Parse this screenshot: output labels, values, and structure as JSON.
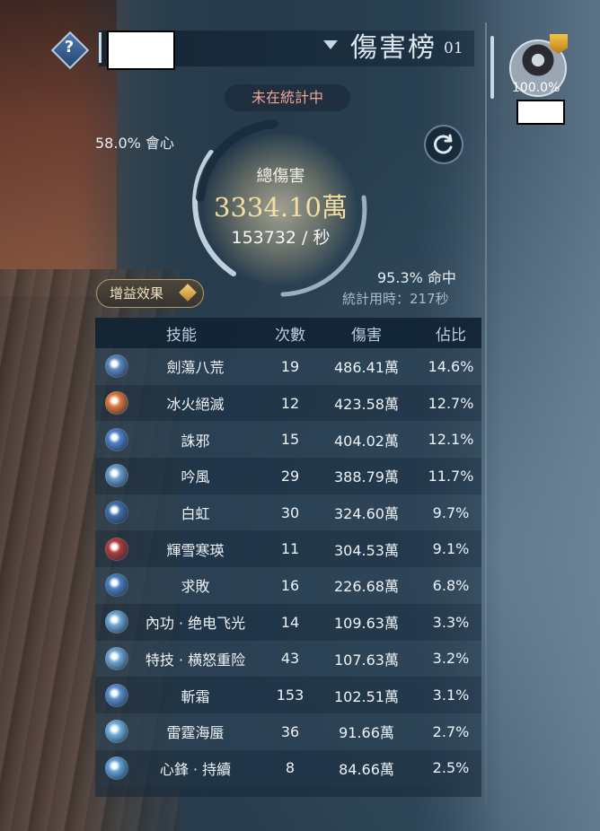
{
  "header": {
    "help_label": "?",
    "rank_title": "傷害榜",
    "rank_number": "01"
  },
  "status": "未在統計中",
  "summary": {
    "crit": "58.0% 會心",
    "total_label": "總傷害",
    "total_value": "3334.10萬",
    "dps": "153732 / 秒",
    "hit": "95.3% 命中",
    "time": "統計用時：217秒"
  },
  "buff_button": "增益效果",
  "table": {
    "headers": [
      "技能",
      "次數",
      "傷害",
      "佔比"
    ],
    "rows": [
      {
        "name": "劍蕩八荒",
        "count": "19",
        "damage": "486.41萬",
        "pct": "14.6%",
        "color": "#5b86c2"
      },
      {
        "name": "冰火絕滅",
        "count": "12",
        "damage": "423.58萬",
        "pct": "12.7%",
        "color": "#e0783a"
      },
      {
        "name": "誅邪",
        "count": "15",
        "damage": "404.02萬",
        "pct": "12.1%",
        "color": "#4f7fc4"
      },
      {
        "name": "吟風",
        "count": "29",
        "damage": "388.79萬",
        "pct": "11.7%",
        "color": "#6a9cd0"
      },
      {
        "name": "白虹",
        "count": "30",
        "damage": "324.60萬",
        "pct": "9.7%",
        "color": "#3f6fab"
      },
      {
        "name": "輝雪寒瑛",
        "count": "11",
        "damage": "304.53萬",
        "pct": "9.1%",
        "color": "#b23b3b"
      },
      {
        "name": "求敗",
        "count": "16",
        "damage": "226.68萬",
        "pct": "6.8%",
        "color": "#4a7fc0"
      },
      {
        "name": "內功 · 绝电飞光",
        "count": "14",
        "damage": "109.63萬",
        "pct": "3.3%",
        "color": "#6ea6d6"
      },
      {
        "name": "特技 · 横怒重险",
        "count": "43",
        "damage": "107.63萬",
        "pct": "3.2%",
        "color": "#6ea6d6"
      },
      {
        "name": "斬霜",
        "count": "153",
        "damage": "102.51萬",
        "pct": "3.1%",
        "color": "#5a8fcd"
      },
      {
        "name": "雷霆海蜃",
        "count": "36",
        "damage": "91.66萬",
        "pct": "2.7%",
        "color": "#6fb0dc"
      },
      {
        "name": "心鋒 · 持續",
        "count": "8",
        "damage": "84.66萬",
        "pct": "2.5%",
        "color": "#5fa0d8"
      }
    ]
  },
  "player": {
    "pct": "100.0%"
  },
  "colors": {
    "gold_value": "#f3dfa4",
    "status_red": "#f0a39a",
    "accent_blue": "#bde0f5"
  }
}
